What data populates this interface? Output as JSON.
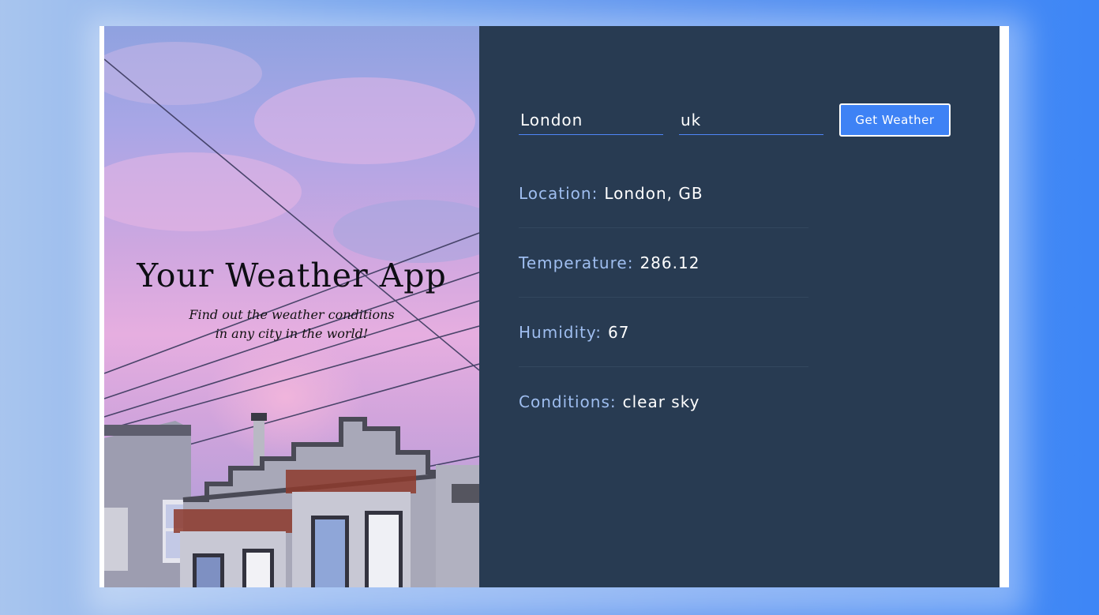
{
  "hero": {
    "title": "Your Weather App",
    "subtitle_line1": "Find out the weather conditions",
    "subtitle_line2": "in any city in the world!"
  },
  "form": {
    "city_value": "London",
    "country_value": "uk",
    "submit_label": "Get Weather"
  },
  "results": [
    {
      "label": "Location:",
      "value": "London, GB"
    },
    {
      "label": "Temperature:",
      "value": "286.12"
    },
    {
      "label": "Humidity:",
      "value": "67"
    },
    {
      "label": "Conditions:",
      "value": "clear sky"
    }
  ],
  "colors": {
    "panel_bg": "#283b52",
    "accent": "#3e82f5",
    "label": "#9fbef0"
  }
}
